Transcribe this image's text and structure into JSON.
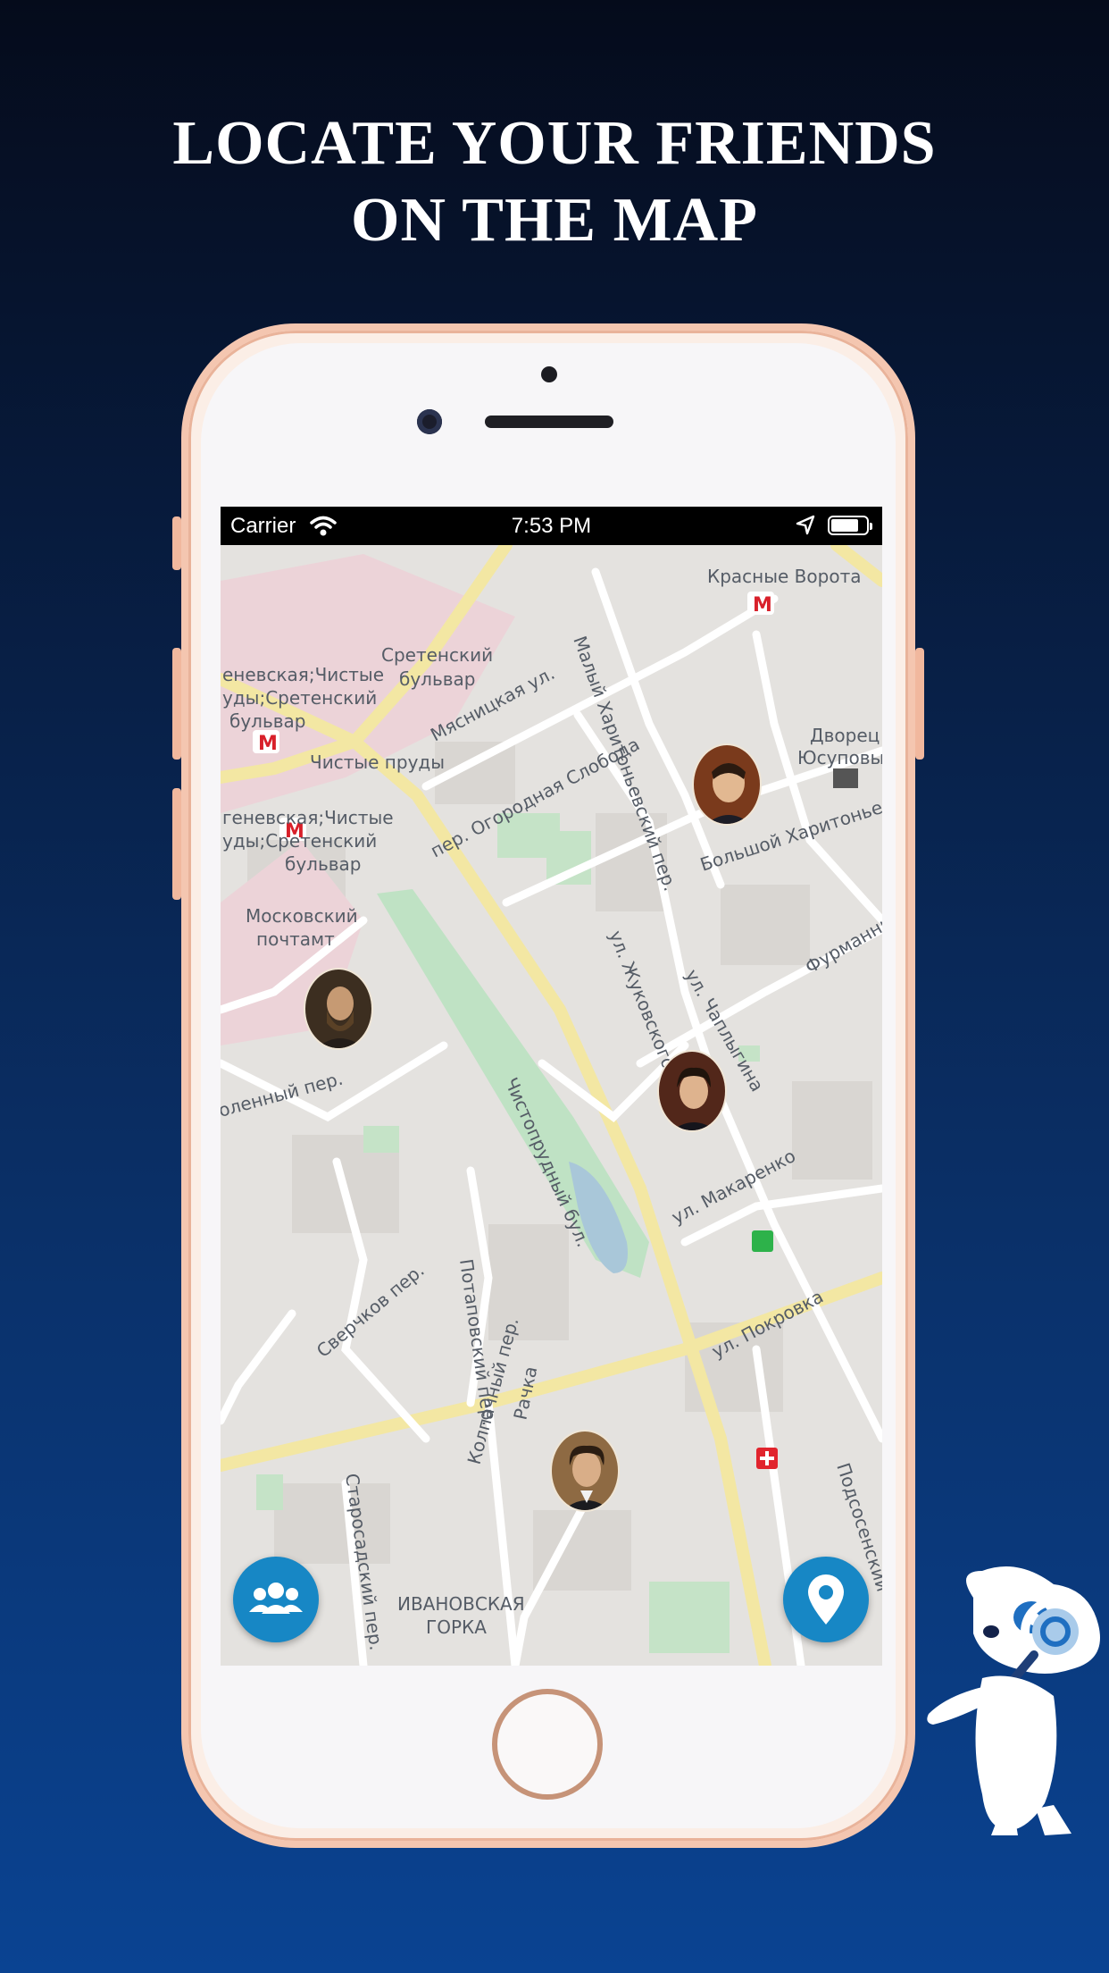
{
  "headline": {
    "line1": "LOCATE YOUR FRIENDS",
    "line2": "ON THE MAP"
  },
  "statusbar": {
    "carrier": "Carrier",
    "time": "7:53 PM"
  },
  "map": {
    "labels": [
      "Красные Ворота",
      "Сретенский",
      "бульвар",
      "еневская;Чистые",
      "уды;Сретенский",
      "бульвар",
      "Чистые пруды",
      "Мясницкая ул.",
      "Малый Харитоньевский пер.",
      "Дворец",
      "Юсуповых",
      "пер. Огородная Слобода",
      "Большой Харитоньевс",
      "геневская;Чистые",
      "уды;Сретенский",
      "бульвар",
      "Московский",
      "почтамт",
      "ул. Жуковского",
      "ул. Чаплыгина",
      "Фурманный",
      "оленный пер.",
      "Чистопрудный бул.",
      "ул. Макаренко",
      "Сверчков пер.",
      "Потаповский пер.",
      "ул. Покровка",
      "Рачка",
      "Колпачный пер.",
      "Старосадский пер.",
      "Подсосенский",
      "ИВАНОВСКАЯ",
      "ГОРКА"
    ]
  },
  "friends": [
    {
      "name": "friend-avatar-1"
    },
    {
      "name": "friend-avatar-2"
    },
    {
      "name": "friend-avatar-3"
    },
    {
      "name": "friend-avatar-4"
    }
  ],
  "buttons": {
    "friends_icon": "friends-group-icon",
    "location_icon": "location-pin-icon"
  },
  "colors": {
    "accent": "#1787c5",
    "phone_frame": "#f4c6b0",
    "background_top": "#050b1b",
    "background_bottom": "#0a4392"
  }
}
